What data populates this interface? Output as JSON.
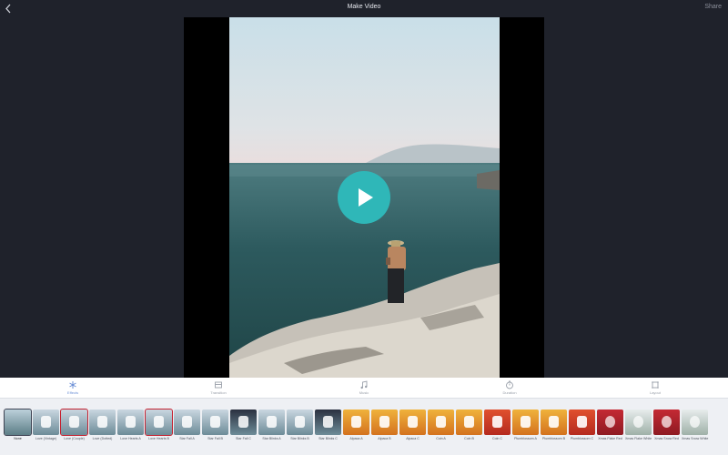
{
  "header": {
    "title": "Make Video",
    "share_label": "Share"
  },
  "tabs": [
    {
      "label": "Effects",
      "icon": "effects-icon",
      "active": true
    },
    {
      "label": "Transition",
      "icon": "transition-icon",
      "active": false
    },
    {
      "label": "Music",
      "icon": "music-icon",
      "active": false
    },
    {
      "label": "Duration",
      "icon": "duration-icon",
      "active": false
    },
    {
      "label": "Layout",
      "icon": "layout-icon",
      "active": false
    }
  ],
  "effects": [
    {
      "label": "None",
      "style": "none",
      "selected": true
    },
    {
      "label": "Love (Vintage)",
      "style": "blue"
    },
    {
      "label": "Love (Couple)",
      "style": "blue-red"
    },
    {
      "label": "Love (Dotted)",
      "style": "blue"
    },
    {
      "label": "Love Hearts A",
      "style": "blue"
    },
    {
      "label": "Love Hearts B",
      "style": "blue-red"
    },
    {
      "label": "Star Fall A",
      "style": "blue"
    },
    {
      "label": "Star Fall B",
      "style": "blue"
    },
    {
      "label": "Star Fall C",
      "style": "blue-dark"
    },
    {
      "label": "Star Blinks A",
      "style": "blue"
    },
    {
      "label": "Star Blinks B",
      "style": "blue"
    },
    {
      "label": "Star Blinks C",
      "style": "blue-dark"
    },
    {
      "label": "Alpaca A",
      "style": "orange"
    },
    {
      "label": "Alpaca B",
      "style": "orange"
    },
    {
      "label": "Alpaca C",
      "style": "orange"
    },
    {
      "label": "Coin A",
      "style": "orange"
    },
    {
      "label": "Coin B",
      "style": "orange"
    },
    {
      "label": "Coin C",
      "style": "red"
    },
    {
      "label": "Plumblossom A",
      "style": "orange"
    },
    {
      "label": "Plumblossom B",
      "style": "orange"
    },
    {
      "label": "Plumblossom C",
      "style": "red"
    },
    {
      "label": "Xmas Flake Red",
      "style": "xmas-red"
    },
    {
      "label": "Xmas Flake White",
      "style": "xmas-white"
    },
    {
      "label": "Xmas Snow Red",
      "style": "xmas-red"
    },
    {
      "label": "Xmas Snow White",
      "style": "xmas-white"
    }
  ],
  "colors": {
    "background": "#1f222b",
    "play_button": "#2fb7b8",
    "active_tab": "#6b8fd6",
    "selection": "#c4202f"
  }
}
